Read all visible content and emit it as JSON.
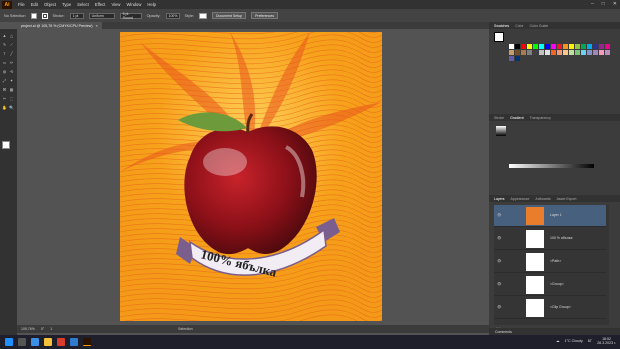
{
  "app": {
    "logo": "Ai"
  },
  "menu": [
    "File",
    "Edit",
    "Object",
    "Type",
    "Select",
    "Effect",
    "View",
    "Window",
    "Help"
  ],
  "control": {
    "selection": "No Selection",
    "stroke_label": "Stroke:",
    "stroke_value": "1 pt",
    "profile": "Uniform",
    "brush": "5 pt. Round",
    "opacity_label": "Opacity:",
    "opacity_value": "100%",
    "style_label": "Style:",
    "doc_setup": "Document Setup",
    "preferences": "Preferences"
  },
  "document_tab": {
    "title": "project.ai @ 105,76 % (CMYK/CPU Preview)",
    "close": "×"
  },
  "artwork": {
    "label": "100% ябълка"
  },
  "status": {
    "zoom": "105,76%",
    "angle": "0°",
    "page": "1",
    "mode": "Selection"
  },
  "right_panel": {
    "top_tabs": [
      "Swatches",
      "Color",
      "Color Guide"
    ],
    "mid_tabs": [
      "Stroke",
      "Gradient",
      "Transparency"
    ],
    "layer_tabs": [
      "Layers",
      "Appearance",
      "Artboards",
      "Asset Export"
    ],
    "layers": [
      {
        "name": "Layer 1",
        "thumb": "#e97d2c"
      },
      {
        "name": "100 % ябълка"
      },
      {
        "name": "<Path>"
      },
      {
        "name": "<Group>"
      },
      {
        "name": "<Clip Group>"
      }
    ],
    "layers_footer": "1 Layer",
    "comments_tab": "Comments"
  },
  "swatch_colors": [
    "#ffffff",
    "#000000",
    "#ff0000",
    "#ffff00",
    "#00ff00",
    "#00ffff",
    "#0000ff",
    "#ff00ff",
    "#ed1c24",
    "#f7941d",
    "#fff200",
    "#8dc63f",
    "#00a651",
    "#00aeef",
    "#2e3192",
    "#92278f",
    "#ec008c",
    "#c69c6d",
    "#754c24",
    "#a67c52",
    "#808080",
    "#404040",
    "#c0c0c0",
    "#e0e0e0",
    "#f26522",
    "#f7977a",
    "#fdc689",
    "#c4df9b",
    "#7cc576",
    "#6dcff6",
    "#8393ca",
    "#a186be",
    "#f49ac1",
    "#bd8cbf",
    "#605ca8",
    "#003471"
  ],
  "taskbar": {
    "weather": "1°C Cloudy",
    "lang": "БГ",
    "time": "18:52",
    "date": "28.3.2023 г."
  }
}
